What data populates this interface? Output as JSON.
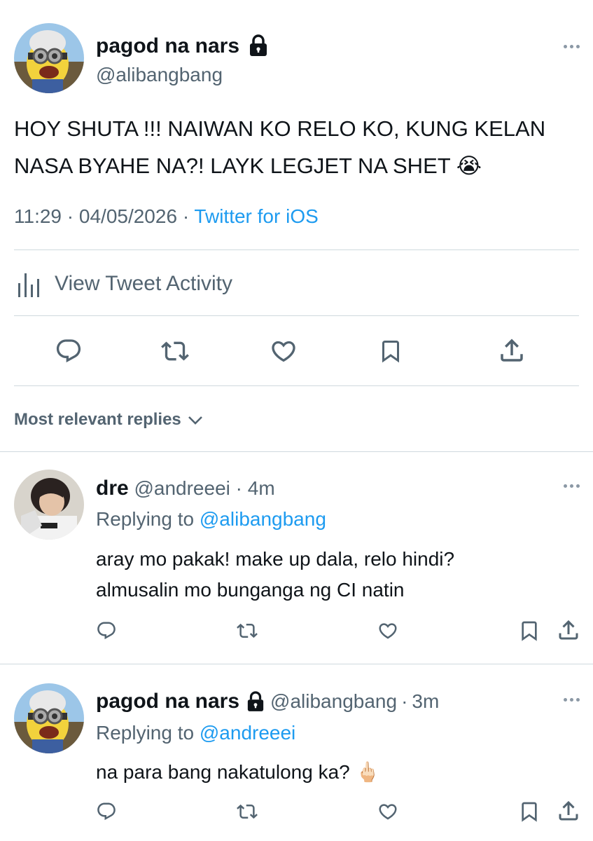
{
  "main_tweet": {
    "author_name": "pagod na nars",
    "author_handle": "@alibangbang",
    "locked_icon": "lock-icon",
    "text_line1": "HOY SHUTA !!! NAIWAN KO RELO KO, KUNG KELAN",
    "text_line2": "NASA BYAHE NA?! LAYK LEGJET NA SHET",
    "emoji": "😭",
    "time": "11:29",
    "date": "04/05/2026",
    "sep1": "·",
    "sep2": "·",
    "source": "Twitter for iOS",
    "activity_label": "View Tweet Activity"
  },
  "sort": {
    "label": "Most relevant replies"
  },
  "replies": [
    {
      "name": "dre",
      "handle": "@andreeei",
      "sep": "·",
      "time": "4m",
      "replying_prefix": "Replying to",
      "replying_handle": "@alibangbang",
      "text_line1": "aray mo pakak! make up dala, relo hindi?",
      "text_line2": "almusalin mo bunganga ng CI natin"
    },
    {
      "name": "pagod na nars",
      "handle": "@alibangbang",
      "sep": "·",
      "time": "3m",
      "replying_prefix": "Replying to",
      "replying_handle": "@andreeei",
      "text_line1": "na para bang nakatulong ka?",
      "emoji": "🖕🏻"
    }
  ],
  "colors": {
    "link": "#1d9bf0",
    "muted": "#536471",
    "divider": "#cfd9de",
    "text": "#0f1419"
  }
}
